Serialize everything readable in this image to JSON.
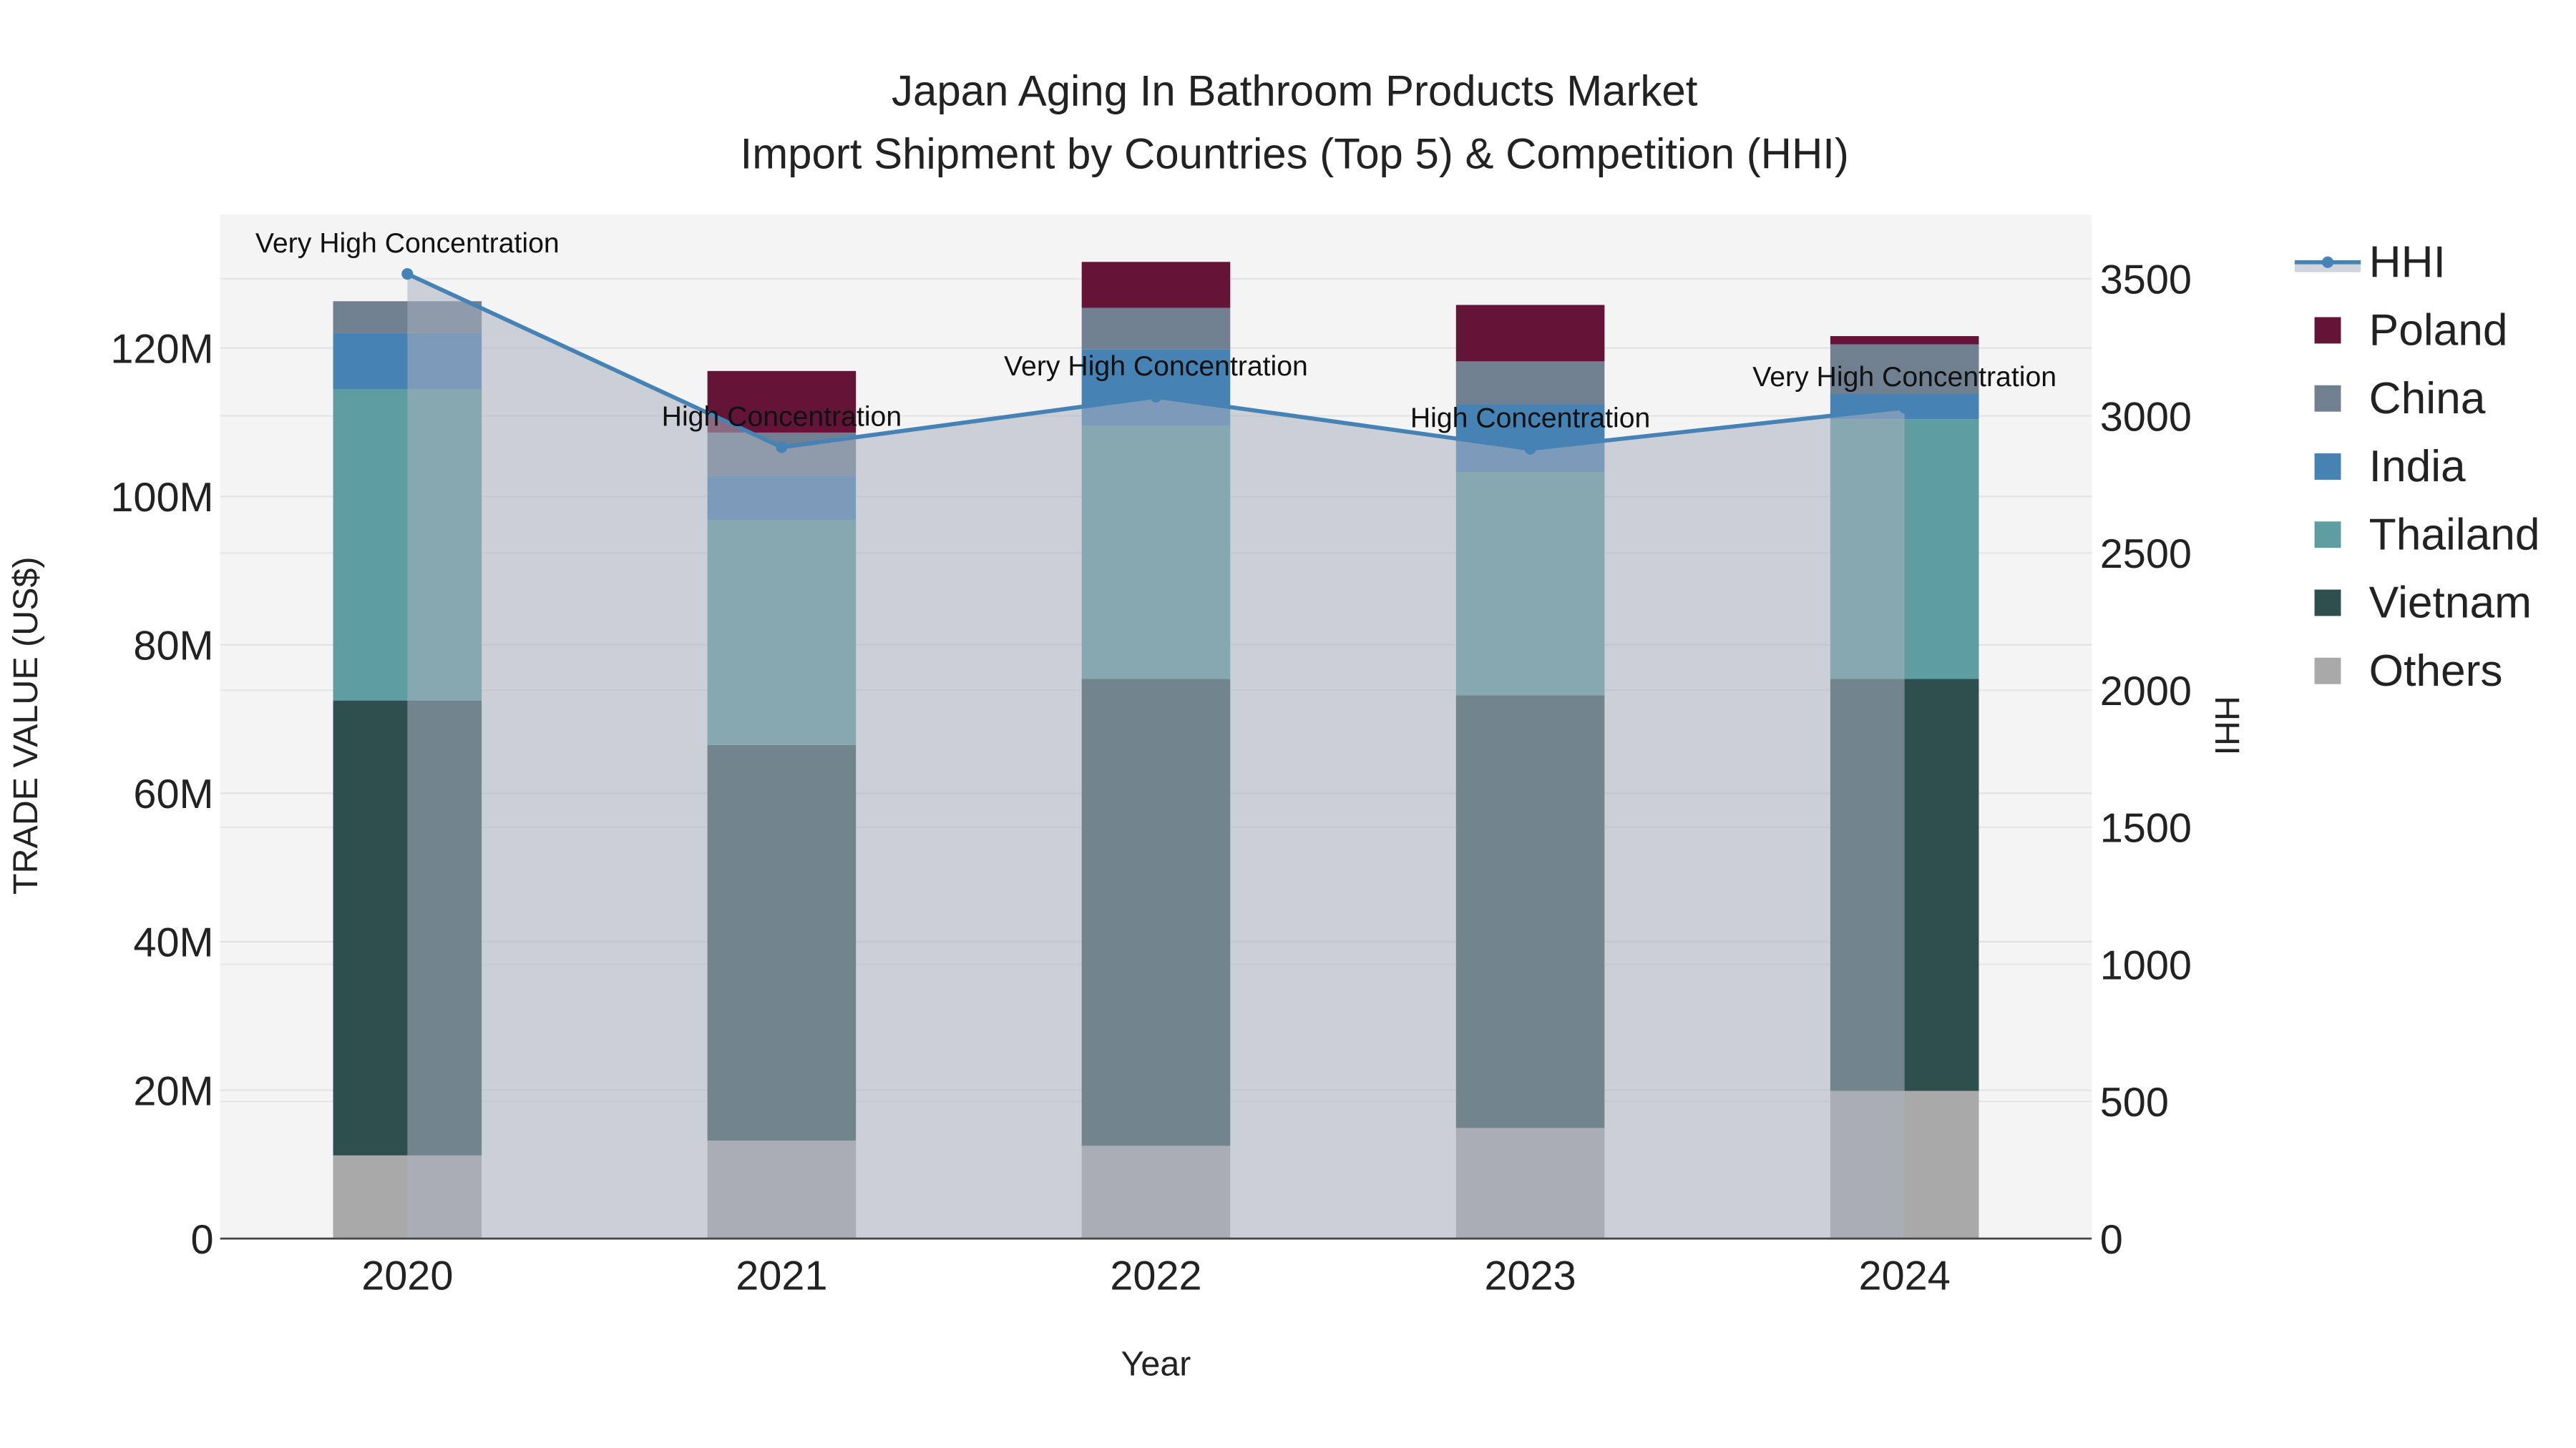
{
  "chart_data": {
    "type": "bar",
    "title": "Japan Aging In Bathroom Products Market",
    "subtitle": "Import Shipment by Countries (Top 5) & Competition (HHI)",
    "xlabel": "Year",
    "ylabel": "TRADE VALUE (US$)",
    "y2label": "HHI",
    "categories": [
      "2020",
      "2021",
      "2022",
      "2023",
      "2024"
    ],
    "ylim": [
      0,
      138
    ],
    "y_unit": "M",
    "y_ticks": [
      0,
      20,
      40,
      60,
      80,
      100,
      120
    ],
    "y_tick_labels": [
      "0",
      "20M",
      "40M",
      "60M",
      "80M",
      "100M",
      "120M"
    ],
    "y2lim": [
      0,
      3735
    ],
    "y2_ticks": [
      0,
      500,
      1000,
      1500,
      2000,
      2500,
      3000,
      3500
    ],
    "stacked": true,
    "series": [
      {
        "name": "Others",
        "color": "#A9A9A9",
        "values": [
          11.2,
          13.2,
          12.5,
          14.9,
          19.9
        ]
      },
      {
        "name": "Vietnam",
        "color": "#2F4F4F",
        "values": [
          61.3,
          53.3,
          62.9,
          58.3,
          55.5
        ]
      },
      {
        "name": "Thailand",
        "color": "#5F9EA0",
        "values": [
          41.9,
          30.3,
          34.1,
          30.1,
          35.0
        ]
      },
      {
        "name": "India",
        "color": "#4682B4",
        "values": [
          7.6,
          6.0,
          10.3,
          9.1,
          3.4
        ]
      },
      {
        "name": "China",
        "color": "#708090",
        "values": [
          4.3,
          5.8,
          5.6,
          5.8,
          6.7
        ]
      },
      {
        "name": "Poland",
        "color": "#641437",
        "values": [
          0,
          8.3,
          6.2,
          7.6,
          1.1
        ]
      }
    ],
    "hhi": {
      "name": "HHI",
      "color": "#4682B4",
      "values": [
        3518,
        2886,
        3070,
        2880,
        3030
      ],
      "annotations": [
        "Very High Concentration",
        "High Concentration",
        "Very High Concentration",
        "High Concentration",
        "Very High Concentration"
      ]
    },
    "legend_order": [
      "HHI",
      "Poland",
      "China",
      "India",
      "Thailand",
      "Vietnam",
      "Others"
    ],
    "legend_placement": "right",
    "grid": true
  }
}
